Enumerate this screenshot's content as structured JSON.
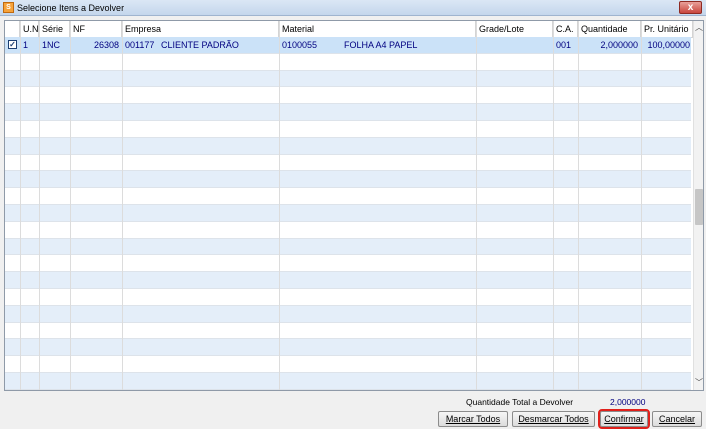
{
  "window": {
    "title": "Selecione Itens a Devolver",
    "close_label": "x"
  },
  "grid": {
    "columns": [
      "U.N.",
      "Série",
      "NF",
      "Empresa",
      "Material",
      "Grade/Lote",
      "C.A.",
      "Quantidade",
      "Pr. Unitário"
    ],
    "rows": [
      {
        "checked": true,
        "un": "1",
        "serie": "1NC",
        "nf": "26308",
        "empresa_code": "001177",
        "empresa_name": "CLIENTE PADRÃO",
        "material_code": "0100055",
        "material_name": "FOLHA A4 PAPEL",
        "grade_lote": "",
        "ca": "001",
        "quantidade": "2,000000",
        "pr_unitario": "100,00000"
      }
    ]
  },
  "footer": {
    "total_label": "Quantidade Total a Devolver",
    "total_value": "2,000000",
    "buttons": {
      "marcar": "Marcar Todos",
      "desmarcar": "Desmarcar Todos",
      "confirmar": "Confirmar",
      "cancelar": "Cancelar"
    }
  }
}
